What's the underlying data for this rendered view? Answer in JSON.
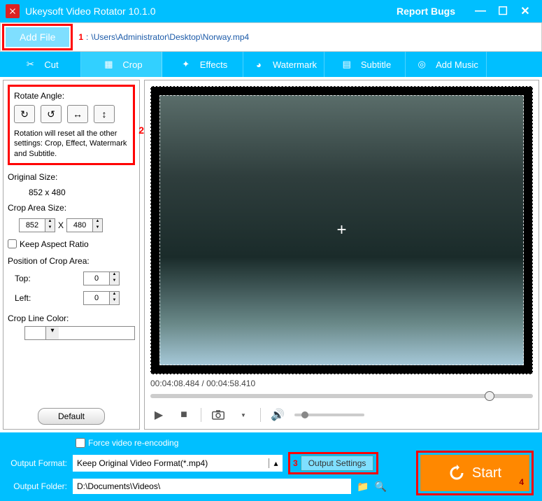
{
  "titlebar": {
    "app_title": "Ukeysoft Video Rotator 10.1.0",
    "report": "Report Bugs"
  },
  "filebar": {
    "add_file": "Add File",
    "marker1": "1",
    "path_prefix": ":",
    "path": "\\Users\\Administrator\\Desktop\\Norway.mp4"
  },
  "tabs": {
    "cut": "Cut",
    "crop": "Crop",
    "effects": "Effects",
    "watermark": "Watermark",
    "subtitle": "Subtitle",
    "add_music": "Add Music"
  },
  "rotate": {
    "label": "Rotate Angle:",
    "note": "Rotation will reset all the other settings: Crop, Effect, Watermark and Subtitle.",
    "marker2": "2"
  },
  "sizes": {
    "original_label": "Original Size:",
    "original_value": "852 x 480",
    "crop_label": "Crop Area Size:",
    "crop_w": "852",
    "x": "X",
    "crop_h": "480",
    "keep_aspect": "Keep Aspect Ratio"
  },
  "position": {
    "label": "Position of Crop Area:",
    "top_label": "Top:",
    "top_val": "0",
    "left_label": "Left:",
    "left_val": "0"
  },
  "cropline": {
    "label": "Crop Line Color:"
  },
  "default_btn": "Default",
  "player": {
    "timecode": "00:04:08.484 / 00:04:58.410"
  },
  "bottom": {
    "force": "Force video re-encoding",
    "out_format_label": "Output Format:",
    "out_format_value": "Keep Original Video Format(*.mp4)",
    "marker3": "3",
    "output_settings": "Output Settings",
    "out_folder_label": "Output Folder:",
    "out_folder_value": "D:\\Documents\\Videos\\",
    "start": "Start",
    "marker4": "4"
  }
}
